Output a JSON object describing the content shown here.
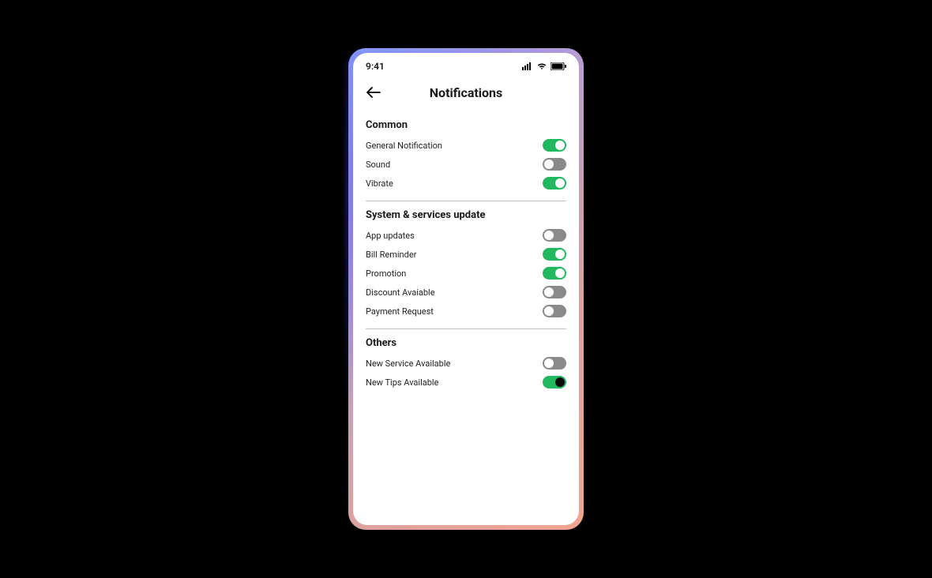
{
  "status": {
    "time": "9:41"
  },
  "header": {
    "title": "Notifications"
  },
  "sections": {
    "common": {
      "title": "Common",
      "items": [
        {
          "label": "General Notification",
          "on": true
        },
        {
          "label": "Sound",
          "on": false
        },
        {
          "label": "Vibrate",
          "on": true
        }
      ]
    },
    "system": {
      "title": "System & services update",
      "items": [
        {
          "label": "App updates",
          "on": false
        },
        {
          "label": "Bill Reminder",
          "on": true
        },
        {
          "label": "Promotion",
          "on": true
        },
        {
          "label": "Discount Avaiable",
          "on": false
        },
        {
          "label": "Payment Request",
          "on": false
        }
      ]
    },
    "others": {
      "title": "Others",
      "items": [
        {
          "label": "New Service Available",
          "on": false
        },
        {
          "label": "New Tips Available",
          "on": true
        }
      ]
    }
  }
}
